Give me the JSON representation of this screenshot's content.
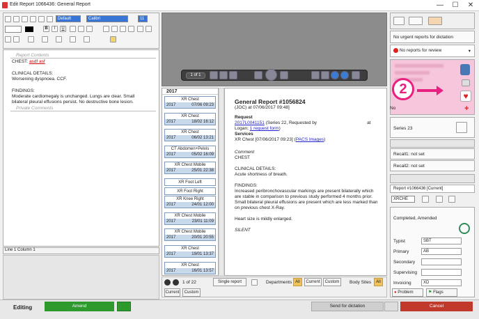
{
  "window": {
    "title": "Edit Report 1066436: General Report",
    "minimize": "—",
    "maximize": "☐",
    "close": "✕"
  },
  "editor": {
    "style_combo": "Default",
    "font_combo": "Calibri",
    "size_combo": "11",
    "section_report": "Report Contents",
    "line_chest_label": "CHEST:",
    "line_chest_value": "asdf asf",
    "clinical_hdr": "CLINICAL DETAILS:",
    "clinical_text": "Worsening dyspnoea.  CCF.",
    "findings_hdr": "FINDINGS:",
    "findings_l1": "Moderate cardiomegaly is unchanged.  Lungs are clear.  Small",
    "findings_l2": "bilateral pleural effusions persist.  No destructive bone lesion.",
    "section_private": "Private Comments",
    "status": "Line 1 Column 1"
  },
  "viewer": {
    "page_counter": "1 of 1"
  },
  "history": {
    "year": "2017",
    "items": [
      {
        "name": "XR Chest",
        "year": "2017",
        "date": "07/06 09:23"
      },
      {
        "name": "XR Chest",
        "year": "2017",
        "date": "18/02 16:12"
      },
      {
        "name": "XR Chest",
        "year": "2017",
        "date": "06/02 13:21"
      },
      {
        "name": "CT Abdomen+Pelvis",
        "year": "2017",
        "date": "05/02 16:09"
      },
      {
        "name": "XR Chest Mobile",
        "year": "2017",
        "date": "25/01 22:38"
      },
      {
        "name": "XR Foot Left"
      },
      {
        "name": "XR Foot Right"
      },
      {
        "name": "XR Knee Right",
        "year": "2017",
        "date": "24/01 12:00"
      },
      {
        "name": "XR Chest Mobile",
        "year": "2017",
        "date": "23/01 11:09"
      },
      {
        "name": "XR Chest Mobile",
        "year": "2017",
        "date": "20/01 20:55"
      },
      {
        "name": "XR Chest",
        "year": "2017",
        "date": "19/01 13:37"
      },
      {
        "name": "XR Chest",
        "year": "2017",
        "date": "16/01 13:57"
      }
    ],
    "pager": "1 of 22",
    "single_report": "Single report",
    "departments": "Departments",
    "all": "All",
    "current": "Current",
    "custom": "Custom",
    "body_sites": "Body Sites"
  },
  "report_view": {
    "title": "General Report #1056824",
    "subtitle": "(JOC) at 07/06/2017 09:48]",
    "request_hdr": "Request",
    "request_link": "2017L0041151",
    "request_text": " (Series 22, Requested by",
    "request_at": "at",
    "request_l2a": "Logan; ",
    "request_l2_link": "1 request form",
    "request_l2b": ")",
    "services_hdr": "Services",
    "services_text": "XR Chest [07/06/2017 09:23] (",
    "services_link": "PACS Images",
    "services_end": ")",
    "comment_hdr": "Comment",
    "comment_text": "CHEST",
    "clinical_hdr": "CLINICAL DETAILS:",
    "clinical_text": "Acute shortness of breath.",
    "findings_hdr": "FINDINGS:",
    "findings_l1": "Increased peribronchovascular markings are present bilaterally which",
    "findings_l2": "are stable in comparison to previous study performed 4 months prior.",
    "findings_l3": "Small bilateral pleural effusions are present which are less marked than",
    "findings_l4": "on previous chest X-Ray.",
    "heart_text": "Heart size is mildly enlarged.",
    "silent": "SILENT"
  },
  "right": {
    "urgent": "No urgent reports for dictation",
    "review": "No reports for review",
    "callout_number": "2",
    "patient_no_prefix": "No",
    "series": "Series 23",
    "recall1": "Recall1: not set",
    "recall2": "Recall2: not set",
    "report_combo": "Report #1066436 [Current]",
    "modality_combo": "XRCHE",
    "status_text": "Completed, Amended",
    "typist_label": "Typist",
    "typist_value": "SBT",
    "primary_label": "Primary",
    "primary_value": "AB",
    "secondary_label": "Secondary",
    "supervising_label": "Supervising",
    "invoicing_label": "Invoicing",
    "invoicing_value": "XD",
    "problem": "Problem",
    "flags": "Flags"
  },
  "bottom": {
    "editing": "Editing",
    "amend": "Amend",
    "send": "Send for dictation",
    "cancel": "Cancel"
  },
  "colors": {
    "amend": "#2e9a2e",
    "cancel": "#c0392b",
    "accent": "#3875d7",
    "pink": "#f6c6dc",
    "callout": "#e8207f"
  }
}
